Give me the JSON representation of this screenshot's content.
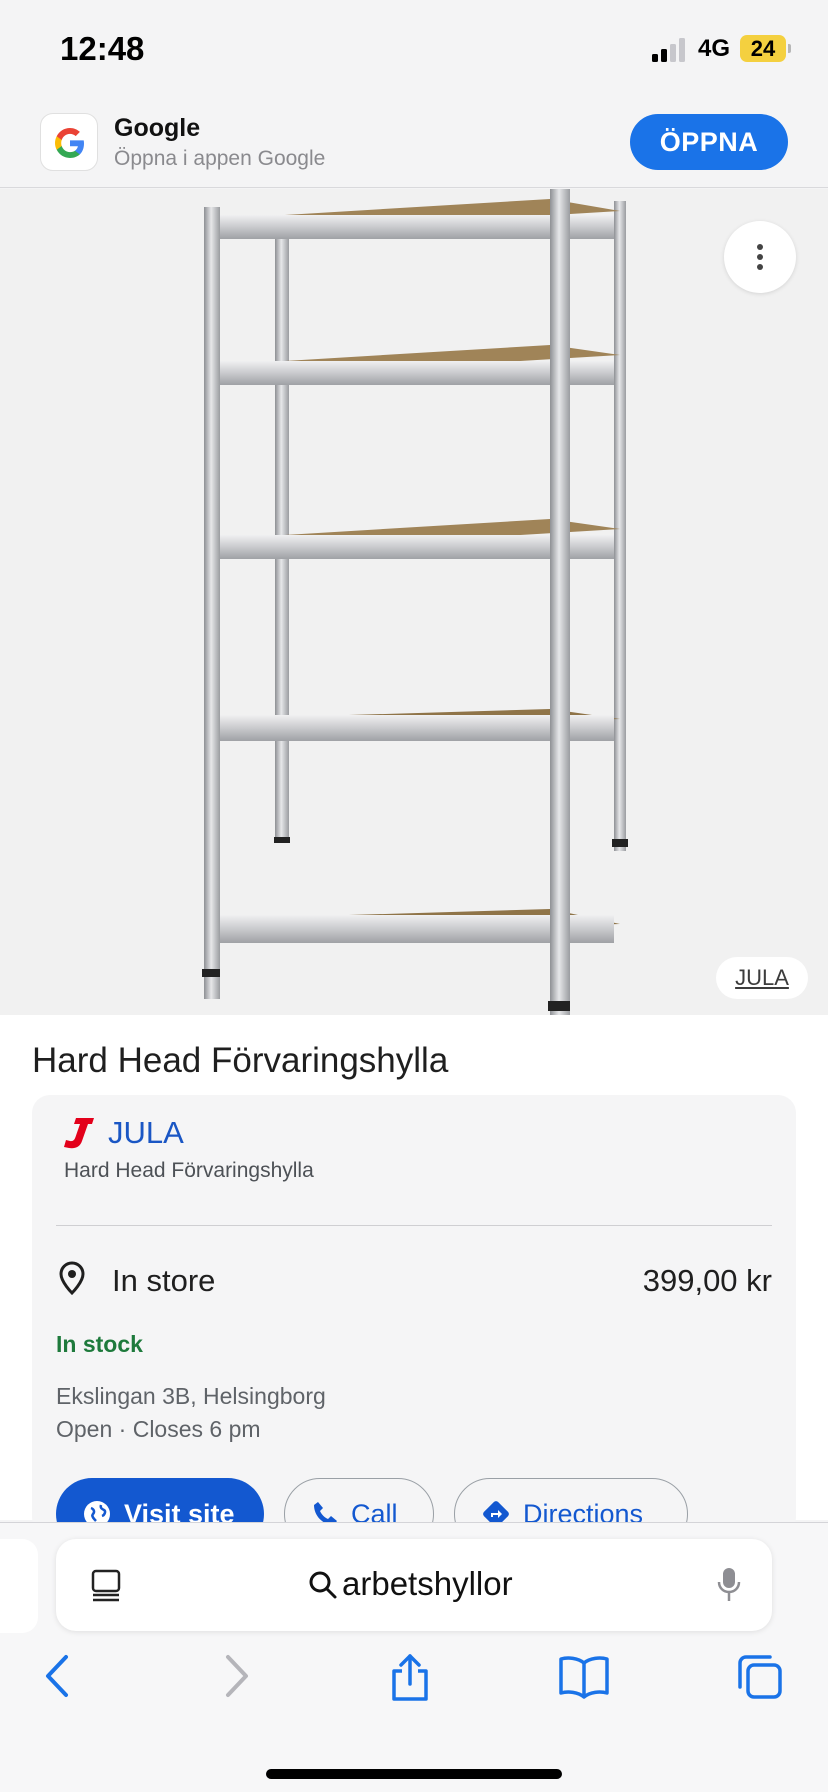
{
  "status_bar": {
    "time": "12:48",
    "network": "4G",
    "battery": "24"
  },
  "app_banner": {
    "title": "Google",
    "subtitle": "Öppna i appen Google",
    "open_label": "ÖPPNA"
  },
  "hero": {
    "source_label": "JULA",
    "more_icon": "more-vert-icon"
  },
  "product": {
    "title": "Hard Head Förvaringshylla"
  },
  "store_card": {
    "store_name": "JULA",
    "store_product": "Hard Head Förvaringshylla",
    "availability_label": "In store",
    "price": "399,00 kr",
    "stock_status": "In stock",
    "address": "Ekslingan 3B, Helsingborg",
    "hours": "Open · Closes 6 pm",
    "actions": {
      "visit": "Visit site",
      "call": "Call",
      "directions": "Directions"
    }
  },
  "browser": {
    "search_text": "arbetshyllor",
    "nav_icons": [
      "back-icon",
      "forward-icon",
      "share-icon",
      "bookmarks-icon",
      "tabs-icon"
    ]
  },
  "colors": {
    "accent": "#1a73e8",
    "link": "#1358d0",
    "stock_green": "#1e7a3c",
    "jula_red": "#e3001b",
    "battery": "#f4d03f"
  }
}
